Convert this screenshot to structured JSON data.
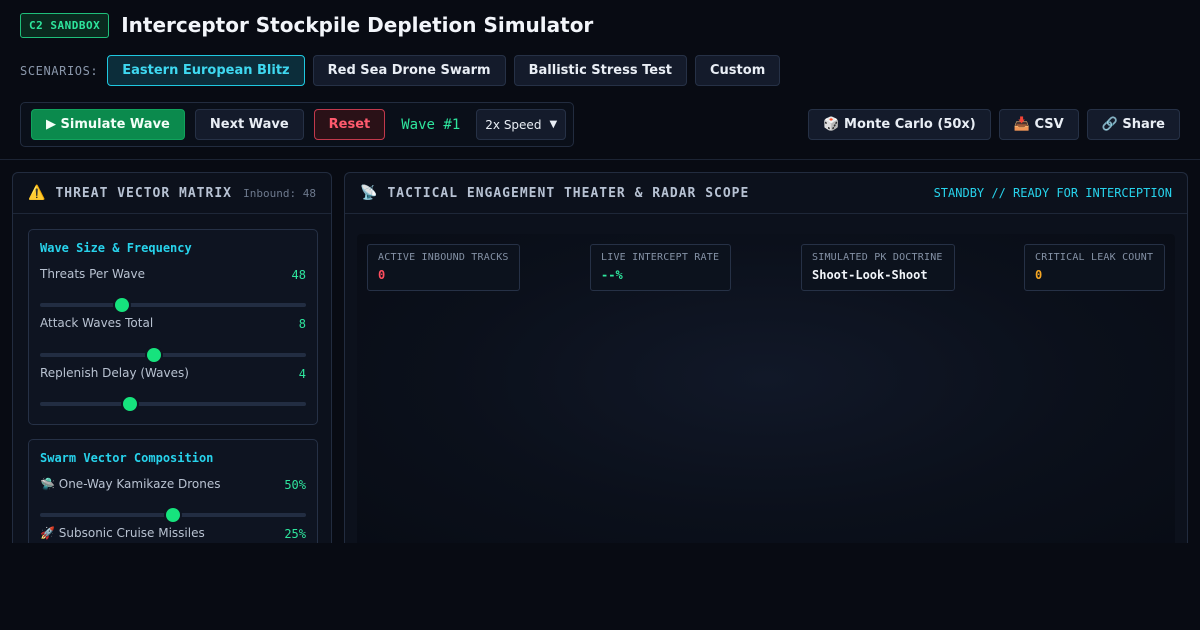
{
  "header": {
    "badge": "C2 SANDBOX",
    "title": "Interceptor Stockpile Depletion Simulator"
  },
  "scenarios": {
    "label": "SCENARIOS:",
    "items": [
      {
        "label": "Eastern European Blitz",
        "active": true
      },
      {
        "label": "Red Sea Drone Swarm",
        "active": false
      },
      {
        "label": "Ballistic Stress Test",
        "active": false
      },
      {
        "label": "Custom",
        "active": false
      }
    ]
  },
  "controls": {
    "simulate": "▶ Simulate Wave",
    "next": "Next Wave",
    "reset": "Reset",
    "wave": "Wave #1",
    "speed": "2x Speed",
    "monte_carlo": "🎲 Monte Carlo (50x)",
    "csv": "📥 CSV",
    "share": "🔗 Share"
  },
  "threat_panel": {
    "title": "THREAT VECTOR MATRIX",
    "inbound": "Inbound: 48",
    "wave_card": {
      "title": "Wave Size & Frequency",
      "rows": [
        {
          "label": "Threats Per Wave",
          "value": "48",
          "fill": 0.31
        },
        {
          "label": "Attack Waves Total",
          "value": "8",
          "fill": 0.43
        },
        {
          "label": "Replenish Delay (Waves)",
          "value": "4",
          "fill": 0.34
        }
      ]
    },
    "swarm_card": {
      "title": "Swarm Vector Composition",
      "rows": [
        {
          "label": "🛸 One-Way Kamikaze Drones",
          "value": "50%",
          "fill": 0.5
        },
        {
          "label": "🚀 Subsonic Cruise Missiles",
          "value": "25%",
          "fill": 0.25
        }
      ]
    }
  },
  "theater": {
    "title": "TACTICAL ENGAGEMENT THEATER & RADAR SCOPE",
    "status": "STANDBY // READY FOR INTERCEPTION",
    "stats": [
      {
        "label": "ACTIVE INBOUND TRACKS",
        "value": "0",
        "color": "#ff4d5e"
      },
      {
        "label": "LIVE INTERCEPT RATE",
        "value": "--%",
        "color": "#2ee59d"
      },
      {
        "label": "SIMULATED PK DOCTRINE",
        "value": "Shoot-Look-Shoot",
        "color": "#f2f5fa"
      },
      {
        "label": "CRITICAL LEAK COUNT",
        "value": "0",
        "color": "#f5a623"
      }
    ]
  }
}
